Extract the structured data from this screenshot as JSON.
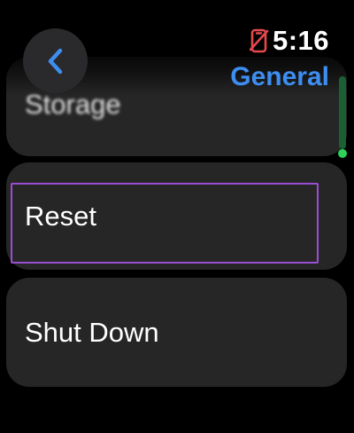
{
  "header": {
    "title": "General",
    "back_icon": "chevron-left-icon"
  },
  "status_bar": {
    "time": "5:16",
    "status_icon": "phone-disconnected-icon"
  },
  "list": {
    "items": [
      {
        "label": "Storage"
      },
      {
        "label": "Reset"
      },
      {
        "label": "Shut Down"
      }
    ],
    "focused_index": 1
  },
  "colors": {
    "accent": "#3d8ef0",
    "focus_ring": "#9a4fd2",
    "status_alert": "#e5484d",
    "scroll_indicator": "#2fd158",
    "row_background": "#262627"
  }
}
